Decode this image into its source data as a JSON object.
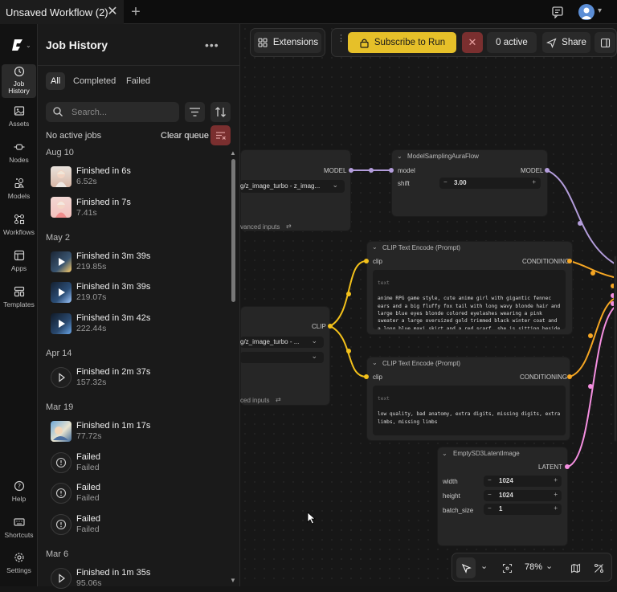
{
  "window": {
    "tab_title": "Unsaved Workflow (2)"
  },
  "rail": {
    "items": [
      {
        "label": "Job History",
        "icon": "history-icon"
      },
      {
        "label": "Assets",
        "icon": "image-icon"
      },
      {
        "label": "Nodes",
        "icon": "nodes-icon"
      },
      {
        "label": "Models",
        "icon": "models-icon"
      },
      {
        "label": "Workflows",
        "icon": "workflow-icon"
      },
      {
        "label": "Apps",
        "icon": "apps-icon"
      },
      {
        "label": "Templates",
        "icon": "templates-icon"
      },
      {
        "label": "Help",
        "icon": "help-icon"
      },
      {
        "label": "Shortcuts",
        "icon": "keyboard-icon"
      },
      {
        "label": "Settings",
        "icon": "gear-icon"
      }
    ]
  },
  "job_history": {
    "title": "Job History",
    "filters": [
      "All",
      "Completed",
      "Failed"
    ],
    "active_filter": "All",
    "search_placeholder": "Search...",
    "no_active_jobs": "No active jobs",
    "clear_queue": "Clear queue",
    "groups": [
      {
        "date": "Aug 10",
        "jobs": [
          {
            "title": "Finished in 6s",
            "sub": "6.52s",
            "thumb": "image"
          },
          {
            "title": "Finished in 7s",
            "sub": "7.41s",
            "thumb": "image"
          }
        ]
      },
      {
        "date": "May 2",
        "jobs": [
          {
            "title": "Finished in 3m 39s",
            "sub": "219.85s",
            "thumb": "video"
          },
          {
            "title": "Finished in 3m 39s",
            "sub": "219.07s",
            "thumb": "video"
          },
          {
            "title": "Finished in 3m 42s",
            "sub": "222.44s",
            "thumb": "video"
          }
        ]
      },
      {
        "date": "Apr 14",
        "jobs": [
          {
            "title": "Finished in 2m 37s",
            "sub": "157.32s",
            "thumb": "play"
          }
        ]
      },
      {
        "date": "Mar 19",
        "jobs": [
          {
            "title": "Finished in 1m 17s",
            "sub": "77.72s",
            "thumb": "image"
          },
          {
            "title": "Failed",
            "sub": "Failed",
            "thumb": "error"
          },
          {
            "title": "Failed",
            "sub": "Failed",
            "thumb": "error"
          },
          {
            "title": "Failed",
            "sub": "Failed",
            "thumb": "error"
          }
        ]
      },
      {
        "date": "Mar 6",
        "jobs": [
          {
            "title": "Finished in 1m 35s",
            "sub": "95.06s",
            "thumb": "play"
          }
        ]
      }
    ]
  },
  "toolbar": {
    "extensions": "Extensions",
    "subscribe": "Subscribe to Run",
    "active": "0 active",
    "share": "Share"
  },
  "nodes": {
    "loader": {
      "output": "MODEL",
      "value": "g/z_image_turbo - z_imag...",
      "adv": "vanced inputs"
    },
    "model_sampling": {
      "title": "ModelSamplingAuraFlow",
      "input": "model",
      "output": "MODEL",
      "shift_label": "shift",
      "shift_value": "3.00"
    },
    "clip_loader": {
      "output": "CLIP",
      "value": "g/z_image_turbo - ...",
      "adv": "ced inputs"
    },
    "clip_pos": {
      "title": "CLIP Text Encode (Prompt)",
      "input": "clip",
      "output": "CONDITIONING",
      "text_label": "text",
      "text": "anime RPG game style, cute anime girl with gigantic fennec ears and a big fluffy fox tail with long wavy blonde hair and large blue eyes blonde colored eyelashes wearing a pink sweater a large oversized gold trimmed black winter coat and a long blue maxi skirt and a red scarf. she is sitting beside a campfire in the wilderness at night playing guitar with a milky way galaxy sky"
    },
    "clip_neg": {
      "title": "CLIP Text Encode (Prompt)",
      "input": "clip",
      "output": "CONDITIONING",
      "text_label": "text",
      "text": "low quality, bad anatomy, extra digits, missing digits, extra limbs, missing limbs"
    },
    "latent": {
      "title": "EmptySD3LatentImage",
      "output": "LATENT",
      "width_label": "width",
      "width": "1024",
      "height_label": "height",
      "height": "1024",
      "batch_label": "batch_size",
      "batch": "1"
    }
  },
  "canvas_controls": {
    "zoom": "78%"
  },
  "colors": {
    "accent_yellow": "#e6c029",
    "model_link": "#b39ddb",
    "clip_link": "#f3c11b",
    "cond_link": "#f5a623",
    "latent_link": "#f48fe0"
  }
}
